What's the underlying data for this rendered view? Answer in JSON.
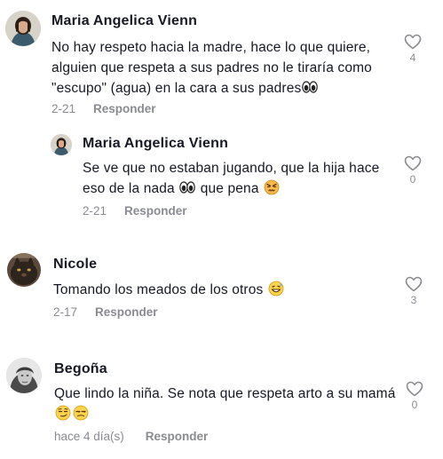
{
  "comments": [
    {
      "author": "Maria Angelica Vienn",
      "text": "No hay respeto hacia la madre, hace lo que quiere, alguien que respeta a sus padres no le tiraría como \"escupo\" (agua) en la cara a sus padres",
      "emoji": [
        "eyes-emoji"
      ],
      "date": "2-21",
      "reply_label": "Responder",
      "likes": "4"
    },
    {
      "author": "Maria Angelica Vienn",
      "text_part1": "Se ve que no estaban jugando, que la hija hace eso de la nada",
      "text_part2": "que pena",
      "emoji": [
        "eyes-emoji",
        "angry-face-emoji"
      ],
      "date": "2-21",
      "reply_label": "Responder",
      "likes": "0"
    },
    {
      "author": "Nicole",
      "text": "Tomando los meados de los otros",
      "emoji": [
        "grinning-sweat-face-emoji"
      ],
      "date": "2-17",
      "reply_label": "Responder",
      "likes": "3"
    },
    {
      "author": "Begoña",
      "text": "Que lindo la niña. Se nota que respeta arto a su mamá",
      "emoji": [
        "smirking-face-emoji",
        "unamused-face-emoji"
      ],
      "date": "hace 4 día(s)",
      "reply_label": "Responder",
      "likes": "0"
    }
  ],
  "colors": {
    "text": "#161823",
    "secondary": "#8a8b91",
    "background": "#ffffff"
  }
}
